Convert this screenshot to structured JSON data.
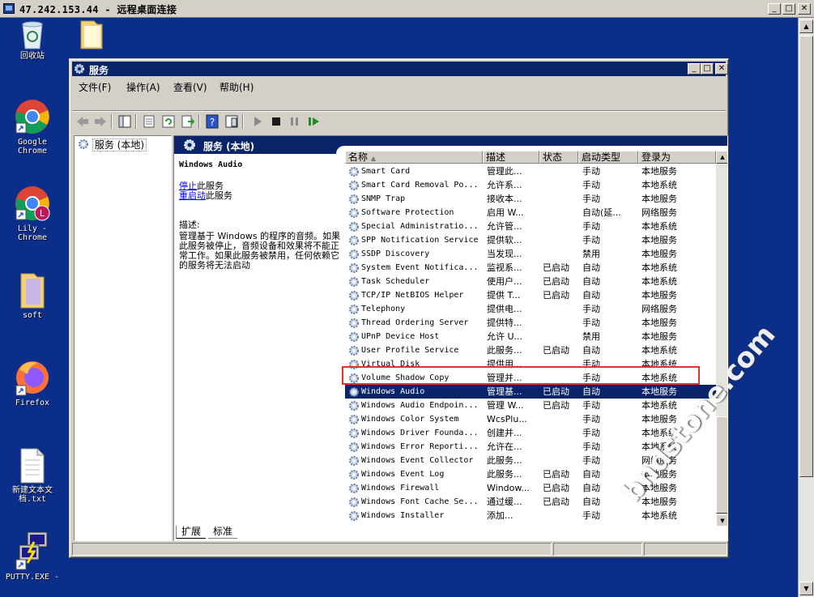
{
  "rdp": {
    "title": "47.242.153.44 - 远程桌面连接"
  },
  "desktop": {
    "icons": [
      {
        "label": "回收站",
        "icon": "recycle-bin-icon"
      },
      {
        "label": "",
        "icon": "folder-icon"
      },
      {
        "label": "Google Chrome",
        "icon": "chrome-icon"
      },
      {
        "label": "Lily - Chrome",
        "icon": "chrome-profile-icon"
      },
      {
        "label": "soft",
        "icon": "folder-icon"
      },
      {
        "label": "Firefox",
        "icon": "firefox-icon"
      },
      {
        "label": "新建文本文档.txt",
        "icon": "text-file-icon"
      },
      {
        "label": "PUTTY.EXE -",
        "icon": "putty-icon"
      }
    ]
  },
  "window": {
    "title": "服务",
    "menu": [
      "文件(F)",
      "操作(A)",
      "查看(V)",
      "帮助(H)"
    ],
    "tree_node": "服务 (本地)",
    "header": "服务 (本地)",
    "detail": {
      "service_name": "Windows Audio",
      "stop_link": "停止",
      "stop_suffix": "此服务",
      "restart_link": "重启动",
      "restart_suffix": "此服务",
      "desc_label": "描述:",
      "desc_text": "管理基于 Windows 的程序的音频。如果此服务被停止，音频设备和效果将不能正常工作。如果此服务被禁用，任何依赖它的服务将无法启动"
    },
    "columns": [
      "名称",
      "描述",
      "状态",
      "启动类型",
      "登录为"
    ],
    "services": [
      {
        "name": "Smart Card",
        "desc": "管理此...",
        "state": "",
        "start": "手动",
        "logon": "本地服务"
      },
      {
        "name": "Smart Card Removal Po...",
        "desc": "允许系...",
        "state": "",
        "start": "手动",
        "logon": "本地系统"
      },
      {
        "name": "SNMP Trap",
        "desc": "接收本...",
        "state": "",
        "start": "手动",
        "logon": "本地服务"
      },
      {
        "name": "Software Protection",
        "desc": "启用 W...",
        "state": "",
        "start": "自动(延...",
        "logon": "网络服务"
      },
      {
        "name": "Special Administratio...",
        "desc": "允许管...",
        "state": "",
        "start": "手动",
        "logon": "本地系统"
      },
      {
        "name": "SPP Notification Service",
        "desc": "提供软...",
        "state": "",
        "start": "手动",
        "logon": "本地服务"
      },
      {
        "name": "SSDP Discovery",
        "desc": "当发现...",
        "state": "",
        "start": "禁用",
        "logon": "本地服务"
      },
      {
        "name": "System Event Notifica...",
        "desc": "监视系...",
        "state": "已启动",
        "start": "自动",
        "logon": "本地系统"
      },
      {
        "name": "Task Scheduler",
        "desc": "使用户...",
        "state": "已启动",
        "start": "自动",
        "logon": "本地系统"
      },
      {
        "name": "TCP/IP NetBIOS Helper",
        "desc": "提供 T...",
        "state": "已启动",
        "start": "自动",
        "logon": "本地服务"
      },
      {
        "name": "Telephony",
        "desc": "提供电...",
        "state": "",
        "start": "手动",
        "logon": "网络服务"
      },
      {
        "name": "Thread Ordering Server",
        "desc": "提供特...",
        "state": "",
        "start": "手动",
        "logon": "本地服务"
      },
      {
        "name": "UPnP Device Host",
        "desc": "允许 U...",
        "state": "",
        "start": "禁用",
        "logon": "本地服务"
      },
      {
        "name": "User Profile Service",
        "desc": "此服务...",
        "state": "已启动",
        "start": "自动",
        "logon": "本地系统"
      },
      {
        "name": "Virtual Disk",
        "desc": "提供用...",
        "state": "",
        "start": "手动",
        "logon": "本地系统"
      },
      {
        "name": "Volume Shadow Copy",
        "desc": "管理并...",
        "state": "",
        "start": "手动",
        "logon": "本地系统"
      },
      {
        "name": "Windows Audio",
        "desc": "管理基...",
        "state": "已启动",
        "start": "自动",
        "logon": "本地服务",
        "selected": true
      },
      {
        "name": "Windows Audio Endpoin...",
        "desc": "管理 W...",
        "state": "已启动",
        "start": "手动",
        "logon": "本地系统"
      },
      {
        "name": "Windows Color System",
        "desc": "WcsPlu...",
        "state": "",
        "start": "手动",
        "logon": "本地服务"
      },
      {
        "name": "Windows Driver Founda...",
        "desc": "创建并...",
        "state": "",
        "start": "手动",
        "logon": "本地系统"
      },
      {
        "name": "Windows Error Reporti...",
        "desc": "允许在...",
        "state": "",
        "start": "手动",
        "logon": "本地系统"
      },
      {
        "name": "Windows Event Collector",
        "desc": "此服务...",
        "state": "",
        "start": "手动",
        "logon": "网络服务"
      },
      {
        "name": "Windows Event Log",
        "desc": "此服务...",
        "state": "已启动",
        "start": "自动",
        "logon": "本地服务"
      },
      {
        "name": "Windows Firewall",
        "desc": "Window...",
        "state": "已启动",
        "start": "自动",
        "logon": "本地服务"
      },
      {
        "name": "Windows Font Cache Se...",
        "desc": "通过缓...",
        "state": "已启动",
        "start": "自动",
        "logon": "本地服务"
      },
      {
        "name": "Windows Installer",
        "desc": "添加...",
        "state": "",
        "start": "手动",
        "logon": "本地系统"
      }
    ],
    "tabs": [
      "扩展",
      "标准"
    ]
  },
  "watermark": "bndstone.com"
}
